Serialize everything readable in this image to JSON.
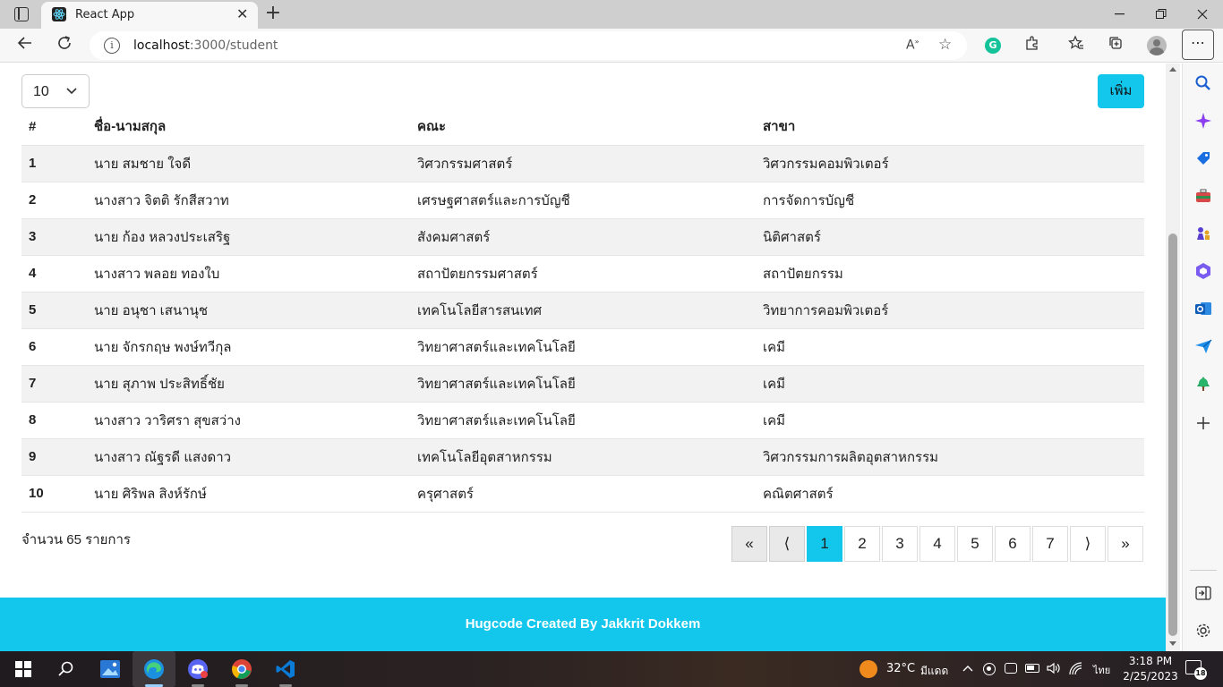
{
  "browser": {
    "tab_title": "React App",
    "url_host": "localhost",
    "url_rest": ":3000/student"
  },
  "page": {
    "page_size": "10",
    "add_button": "เพิ่ม",
    "columns": [
      "#",
      "ชื่อ-นามสกุล",
      "คณะ",
      "สาขา"
    ],
    "rows": [
      [
        "1",
        "นาย สมชาย ใจดี",
        "วิศวกรรมศาสตร์",
        "วิศวกรรมคอมพิวเตอร์"
      ],
      [
        "2",
        "นางสาว จิตติ รักสีสวาท",
        "เศรษฐศาสตร์และการบัญชี",
        "การจัดการบัญชี"
      ],
      [
        "3",
        "นาย ก้อง หลวงประเสริฐ",
        "สังคมศาสตร์",
        "นิติศาสตร์"
      ],
      [
        "4",
        "นางสาว พลอย ทองใบ",
        "สถาปัตยกรรมศาสตร์",
        "สถาปัตยกรรม"
      ],
      [
        "5",
        "นาย อนุชา เสนานุช",
        "เทคโนโลยีสารสนเทศ",
        "วิทยาการคอมพิวเตอร์"
      ],
      [
        "6",
        "นาย จักรกฤษ พงษ์ทวีกุล",
        "วิทยาศาสตร์และเทคโนโลยี",
        "เคมี"
      ],
      [
        "7",
        "นาย สุภาพ ประสิทธิ์ชัย",
        "วิทยาศาสตร์และเทคโนโลยี",
        "เคมี"
      ],
      [
        "8",
        "นางสาว วาริศรา สุขสว่าง",
        "วิทยาศาสตร์และเทคโนโลยี",
        "เคมี"
      ],
      [
        "9",
        "นางสาว ณัฐรดี แสงดาว",
        "เทคโนโลยีอุตสาหกรรม",
        "วิศวกรรมการผลิตอุตสาหกรรม"
      ],
      [
        "10",
        "นาย ศิริพล สิงห์รักษ์",
        "ครุศาสตร์",
        "คณิตศาสตร์"
      ]
    ],
    "total_text": "จำนวน 65 รายการ",
    "pager": {
      "first": "«",
      "prev": "⟨",
      "pages": [
        "1",
        "2",
        "3",
        "4",
        "5",
        "6",
        "7"
      ],
      "active": "1",
      "next": "⟩",
      "last": "»"
    },
    "footer": "Hugcode Created By Jakkrit Dokkem",
    "accent_color": "#13c6ec"
  },
  "taskbar": {
    "temperature": "32°C",
    "weather": "มีแดด",
    "language": "ไทย",
    "time": "3:18 PM",
    "date": "2/25/2023",
    "notification_count": "18"
  }
}
